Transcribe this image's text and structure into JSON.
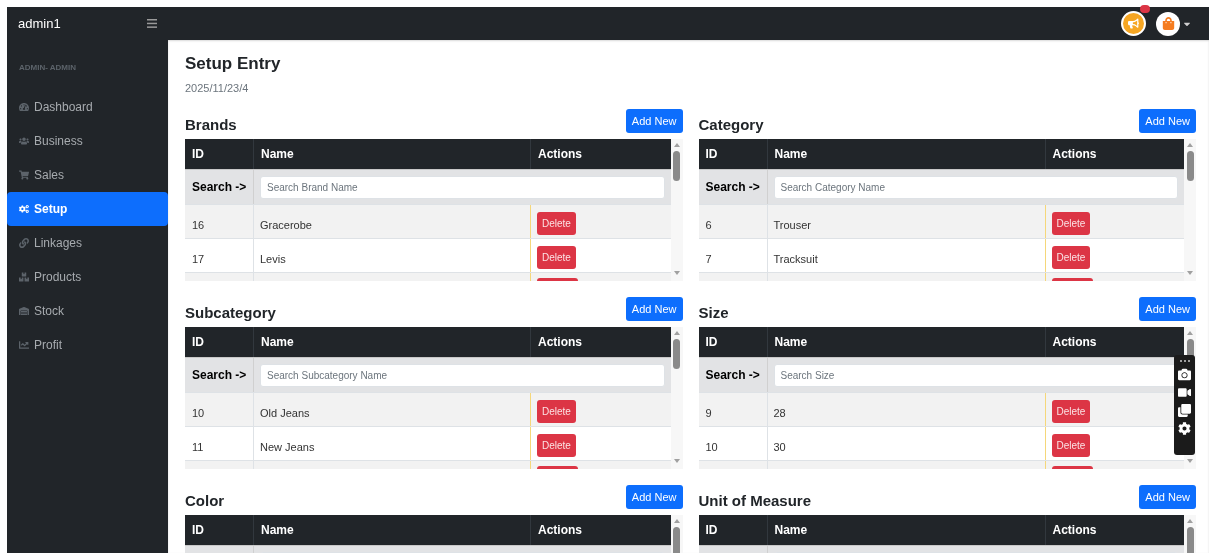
{
  "topbar": {
    "brand": "admin1"
  },
  "sidebar": {
    "section_label": "ADMIN- ADMIN",
    "items": [
      {
        "label": "Dashboard",
        "selected": false
      },
      {
        "label": "Business",
        "selected": false
      },
      {
        "label": "Sales",
        "selected": false
      },
      {
        "label": "Setup",
        "selected": true
      },
      {
        "label": "Linkages",
        "selected": false
      },
      {
        "label": "Products",
        "selected": false
      },
      {
        "label": "Stock",
        "selected": false
      },
      {
        "label": "Profit",
        "selected": false
      }
    ]
  },
  "page": {
    "title": "Setup Entry",
    "subtitle": "2025/11/23/4"
  },
  "panels": [
    {
      "title": "Brands",
      "button": "Add New",
      "columns": [
        "ID",
        "Name",
        "Actions"
      ],
      "search": {
        "label": "Search ->",
        "placeholder": "Search Brand Name"
      },
      "rows": [
        {
          "kind": "full",
          "id": "16",
          "name": "Gracerobe",
          "action": "Delete"
        },
        {
          "kind": "full",
          "id": "17",
          "name": "Levis",
          "action": "Delete"
        },
        {
          "kind": "cut"
        }
      ]
    },
    {
      "title": "Category",
      "button": "Add New",
      "columns": [
        "ID",
        "Name",
        "Actions"
      ],
      "search": {
        "label": "Search ->",
        "placeholder": "Search Category Name"
      },
      "rows": [
        {
          "kind": "full",
          "id": "6",
          "name": "Trouser",
          "action": "Delete"
        },
        {
          "kind": "full",
          "id": "7",
          "name": "Tracksuit",
          "action": "Delete"
        },
        {
          "kind": "cut"
        }
      ]
    },
    {
      "title": "Subcategory",
      "button": "Add New",
      "columns": [
        "ID",
        "Name",
        "Actions"
      ],
      "search": {
        "label": "Search ->",
        "placeholder": "Search Subcategory Name"
      },
      "rows": [
        {
          "kind": "full",
          "id": "10",
          "name": "Old Jeans",
          "action": "Delete"
        },
        {
          "kind": "full",
          "id": "11",
          "name": "New Jeans",
          "action": "Delete"
        },
        {
          "kind": "cut"
        }
      ]
    },
    {
      "title": "Size",
      "button": "Add New",
      "columns": [
        "ID",
        "Name",
        "Actions"
      ],
      "search": {
        "label": "Search ->",
        "placeholder": "Search Size"
      },
      "rows": [
        {
          "kind": "full",
          "id": "9",
          "name": "28",
          "action": "Delete"
        },
        {
          "kind": "full",
          "id": "10",
          "name": "30",
          "action": "Delete"
        },
        {
          "kind": "cut"
        }
      ]
    },
    {
      "title": "Color",
      "button": "Add New",
      "columns": [
        "ID",
        "Name",
        "Actions"
      ]
    },
    {
      "title": "Unit of Measure",
      "button": "Add New",
      "columns": [
        "ID",
        "Name",
        "Actions"
      ]
    }
  ]
}
